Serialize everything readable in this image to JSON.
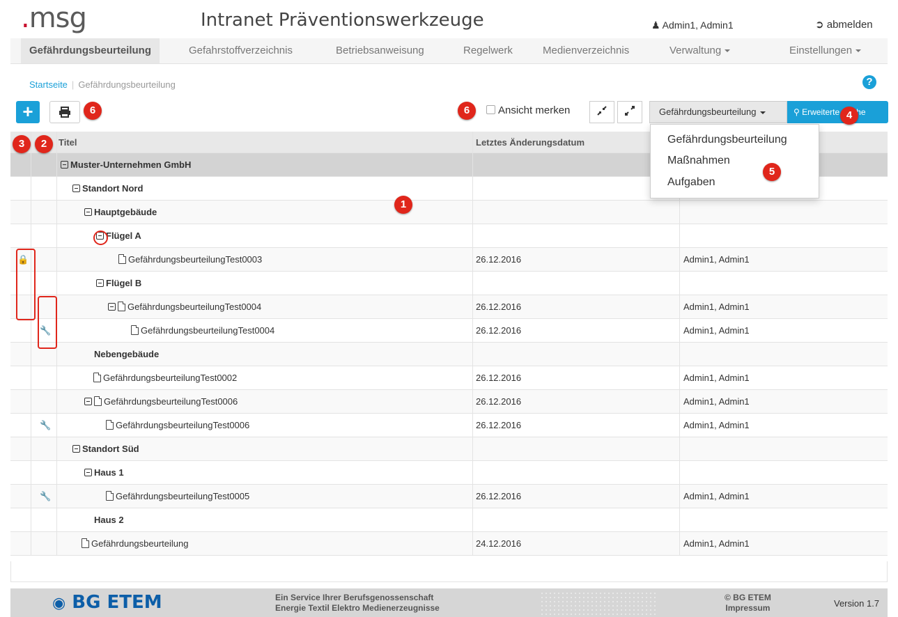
{
  "header": {
    "logo_text": "msg",
    "title": "Intranet Präventionswerkzeuge",
    "user": "Admin1, Admin1",
    "logout_label": "abmelden"
  },
  "nav": {
    "items": [
      {
        "label": "Gefährdungsbeurteilung"
      },
      {
        "label": "Gefahrstoffverzeichnis"
      },
      {
        "label": "Betriebsanweisung"
      },
      {
        "label": "Regelwerk"
      },
      {
        "label": "Medienverzeichnis"
      },
      {
        "label": "Verwaltung"
      },
      {
        "label": "Einstellungen"
      }
    ]
  },
  "breadcrumb": {
    "home": "Startseite",
    "current": "Gefährdungsbeurteilung"
  },
  "toolbar": {
    "remember_label": "Ansicht merken",
    "select_value": "Gefährdungsbeurteilung",
    "search_label": "Erweiterte Suche"
  },
  "dropdown": {
    "options": [
      "Gefährdungsbeurteilung",
      "Maßnahmen",
      "Aufgaben"
    ]
  },
  "table": {
    "headers": {
      "title": "Titel",
      "date": "Letztes Änderungsdatum"
    },
    "rows": [
      {
        "title": "Muster-Unternehmen GmbH"
      },
      {
        "title": "Standort Nord"
      },
      {
        "title": "Hauptgebäude"
      },
      {
        "title": "Flügel A"
      },
      {
        "title": "GefährdungsbeurteilungTest0003",
        "date": "26.12.2016",
        "author": "Admin1, Admin1"
      },
      {
        "title": "Flügel B"
      },
      {
        "title": "GefährdungsbeurteilungTest0004",
        "date": "26.12.2016",
        "author": "Admin1, Admin1"
      },
      {
        "title": "GefährdungsbeurteilungTest0004",
        "date": "26.12.2016",
        "author": "Admin1, Admin1"
      },
      {
        "title": "Nebengebäude"
      },
      {
        "title": "GefährdungsbeurteilungTest0002",
        "date": "26.12.2016",
        "author": "Admin1, Admin1"
      },
      {
        "title": "GefährdungsbeurteilungTest0006",
        "date": "26.12.2016",
        "author": "Admin1, Admin1"
      },
      {
        "title": "GefährdungsbeurteilungTest0006",
        "date": "26.12.2016",
        "author": "Admin1, Admin1"
      },
      {
        "title": "Standort Süd"
      },
      {
        "title": "Haus 1"
      },
      {
        "title": "GefährdungsbeurteilungTest0005",
        "date": "26.12.2016",
        "author": "Admin1, Admin1"
      },
      {
        "title": "Haus 2"
      },
      {
        "title": "Gefährdungsbeurteilung",
        "date": "24.12.2016",
        "author": "Admin1, Admin1"
      }
    ]
  },
  "badges": {
    "b1": "1",
    "b2": "2",
    "b3": "3",
    "b4": "4",
    "b5": "5",
    "b6": "6"
  },
  "footer": {
    "logo": "BG ETEM",
    "service_line1": "Ein Service Ihrer Berufsgenossenschaft",
    "service_line2": "Energie Textil Elektro Medienerzeugnisse",
    "copyright": "© BG ETEM",
    "impressum": "Impressum",
    "version": "Version 1.7"
  },
  "colors": {
    "accent": "#1aa0d8",
    "badge": "#e0261b",
    "brand_footer": "#0c5ea8"
  }
}
